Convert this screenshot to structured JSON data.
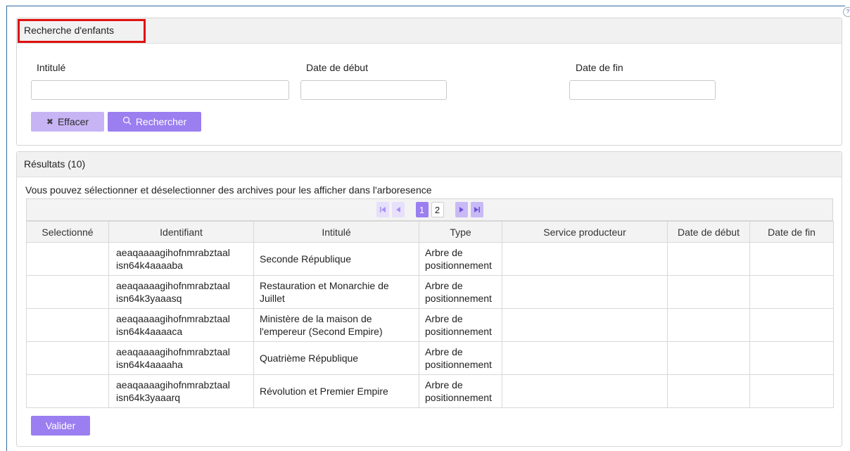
{
  "search": {
    "title": "Recherche d'enfants",
    "fields": {
      "title_label": "Intitulé",
      "title_value": "",
      "start_label": "Date de début",
      "start_value": "",
      "end_label": "Date de fin",
      "end_value": ""
    },
    "clear_label": "Effacer",
    "search_label": "Rechercher"
  },
  "results": {
    "title": "Résultats (10)",
    "info": "Vous pouvez sélectionner et déselectionner des archives pour les afficher dans l'arboresence",
    "pagination": {
      "pages": [
        "1",
        "2"
      ],
      "current": "1"
    },
    "columns": [
      "Selectionné",
      "Identifiant",
      "Intitulé",
      "Type",
      "Service producteur",
      "Date de début",
      "Date de fin"
    ],
    "rows": [
      {
        "selected": "",
        "id": "aeaqaaaagihofnmrabztaal\nisn64k4aaaaba",
        "title": "Seconde République",
        "type": "Arbre de\npositionnement",
        "producer": "",
        "start": "",
        "end": ""
      },
      {
        "selected": "",
        "id": "aeaqaaaagihofnmrabztaal\nisn64k3yaaasq",
        "title": "Restauration et Monarchie de Juillet",
        "type": "Arbre de\npositionnement",
        "producer": "",
        "start": "",
        "end": ""
      },
      {
        "selected": "",
        "id": "aeaqaaaagihofnmrabztaal\nisn64k4aaaaca",
        "title": "Ministère de la maison de l'empereur (Second Empire)",
        "type": "Arbre de\npositionnement",
        "producer": "",
        "start": "",
        "end": ""
      },
      {
        "selected": "",
        "id": "aeaqaaaagihofnmrabztaal\nisn64k4aaaaha",
        "title": "Quatrième République",
        "type": "Arbre de\npositionnement",
        "producer": "",
        "start": "",
        "end": ""
      },
      {
        "selected": "",
        "id": "aeaqaaaagihofnmrabztaal\nisn64k3yaaarq",
        "title": "Révolution et Premier Empire",
        "type": "Arbre de\npositionnement",
        "producer": "",
        "start": "",
        "end": ""
      }
    ],
    "validate_label": "Valider"
  },
  "icons": {
    "clear": "close-icon",
    "search": "search-icon",
    "first": "first-page-icon",
    "prev": "previous-page-icon",
    "next": "next-page-icon",
    "last": "last-page-icon"
  },
  "colors": {
    "accent": "#9b7ef0",
    "accent_light": "#c7b4f5",
    "highlight": "#e01010",
    "panel_header": "#f1f1f1"
  }
}
